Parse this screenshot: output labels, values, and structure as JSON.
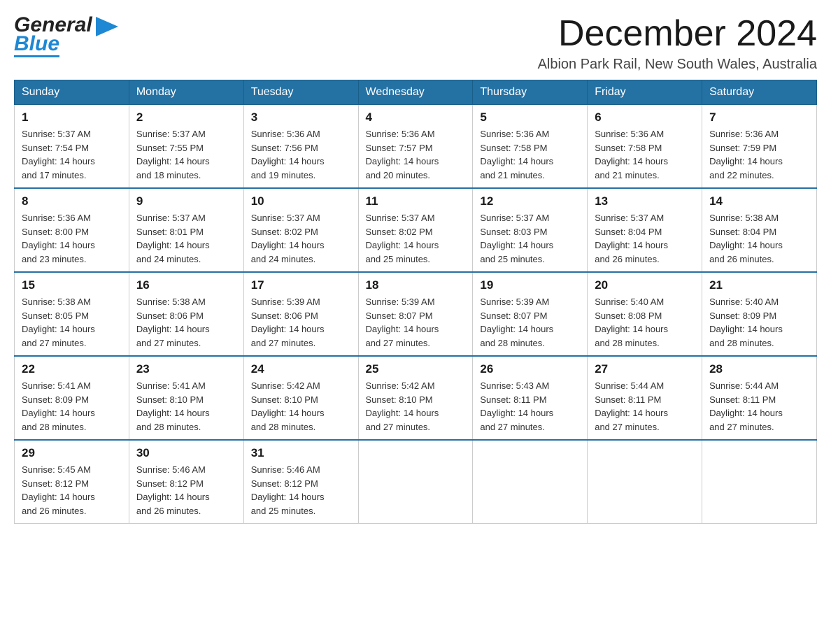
{
  "header": {
    "logo_general": "General",
    "logo_blue": "Blue",
    "month_title": "December 2024",
    "location": "Albion Park Rail, New South Wales, Australia"
  },
  "days_of_week": [
    "Sunday",
    "Monday",
    "Tuesday",
    "Wednesday",
    "Thursday",
    "Friday",
    "Saturday"
  ],
  "weeks": [
    [
      {
        "day": "1",
        "sunrise": "5:37 AM",
        "sunset": "7:54 PM",
        "daylight": "14 hours and 17 minutes."
      },
      {
        "day": "2",
        "sunrise": "5:37 AM",
        "sunset": "7:55 PM",
        "daylight": "14 hours and 18 minutes."
      },
      {
        "day": "3",
        "sunrise": "5:36 AM",
        "sunset": "7:56 PM",
        "daylight": "14 hours and 19 minutes."
      },
      {
        "day": "4",
        "sunrise": "5:36 AM",
        "sunset": "7:57 PM",
        "daylight": "14 hours and 20 minutes."
      },
      {
        "day": "5",
        "sunrise": "5:36 AM",
        "sunset": "7:58 PM",
        "daylight": "14 hours and 21 minutes."
      },
      {
        "day": "6",
        "sunrise": "5:36 AM",
        "sunset": "7:58 PM",
        "daylight": "14 hours and 21 minutes."
      },
      {
        "day": "7",
        "sunrise": "5:36 AM",
        "sunset": "7:59 PM",
        "daylight": "14 hours and 22 minutes."
      }
    ],
    [
      {
        "day": "8",
        "sunrise": "5:36 AM",
        "sunset": "8:00 PM",
        "daylight": "14 hours and 23 minutes."
      },
      {
        "day": "9",
        "sunrise": "5:37 AM",
        "sunset": "8:01 PM",
        "daylight": "14 hours and 24 minutes."
      },
      {
        "day": "10",
        "sunrise": "5:37 AM",
        "sunset": "8:02 PM",
        "daylight": "14 hours and 24 minutes."
      },
      {
        "day": "11",
        "sunrise": "5:37 AM",
        "sunset": "8:02 PM",
        "daylight": "14 hours and 25 minutes."
      },
      {
        "day": "12",
        "sunrise": "5:37 AM",
        "sunset": "8:03 PM",
        "daylight": "14 hours and 25 minutes."
      },
      {
        "day": "13",
        "sunrise": "5:37 AM",
        "sunset": "8:04 PM",
        "daylight": "14 hours and 26 minutes."
      },
      {
        "day": "14",
        "sunrise": "5:38 AM",
        "sunset": "8:04 PM",
        "daylight": "14 hours and 26 minutes."
      }
    ],
    [
      {
        "day": "15",
        "sunrise": "5:38 AM",
        "sunset": "8:05 PM",
        "daylight": "14 hours and 27 minutes."
      },
      {
        "day": "16",
        "sunrise": "5:38 AM",
        "sunset": "8:06 PM",
        "daylight": "14 hours and 27 minutes."
      },
      {
        "day": "17",
        "sunrise": "5:39 AM",
        "sunset": "8:06 PM",
        "daylight": "14 hours and 27 minutes."
      },
      {
        "day": "18",
        "sunrise": "5:39 AM",
        "sunset": "8:07 PM",
        "daylight": "14 hours and 27 minutes."
      },
      {
        "day": "19",
        "sunrise": "5:39 AM",
        "sunset": "8:07 PM",
        "daylight": "14 hours and 28 minutes."
      },
      {
        "day": "20",
        "sunrise": "5:40 AM",
        "sunset": "8:08 PM",
        "daylight": "14 hours and 28 minutes."
      },
      {
        "day": "21",
        "sunrise": "5:40 AM",
        "sunset": "8:09 PM",
        "daylight": "14 hours and 28 minutes."
      }
    ],
    [
      {
        "day": "22",
        "sunrise": "5:41 AM",
        "sunset": "8:09 PM",
        "daylight": "14 hours and 28 minutes."
      },
      {
        "day": "23",
        "sunrise": "5:41 AM",
        "sunset": "8:10 PM",
        "daylight": "14 hours and 28 minutes."
      },
      {
        "day": "24",
        "sunrise": "5:42 AM",
        "sunset": "8:10 PM",
        "daylight": "14 hours and 28 minutes."
      },
      {
        "day": "25",
        "sunrise": "5:42 AM",
        "sunset": "8:10 PM",
        "daylight": "14 hours and 27 minutes."
      },
      {
        "day": "26",
        "sunrise": "5:43 AM",
        "sunset": "8:11 PM",
        "daylight": "14 hours and 27 minutes."
      },
      {
        "day": "27",
        "sunrise": "5:44 AM",
        "sunset": "8:11 PM",
        "daylight": "14 hours and 27 minutes."
      },
      {
        "day": "28",
        "sunrise": "5:44 AM",
        "sunset": "8:11 PM",
        "daylight": "14 hours and 27 minutes."
      }
    ],
    [
      {
        "day": "29",
        "sunrise": "5:45 AM",
        "sunset": "8:12 PM",
        "daylight": "14 hours and 26 minutes."
      },
      {
        "day": "30",
        "sunrise": "5:46 AM",
        "sunset": "8:12 PM",
        "daylight": "14 hours and 26 minutes."
      },
      {
        "day": "31",
        "sunrise": "5:46 AM",
        "sunset": "8:12 PM",
        "daylight": "14 hours and 25 minutes."
      },
      null,
      null,
      null,
      null
    ]
  ],
  "labels": {
    "sunrise_prefix": "Sunrise: ",
    "sunset_prefix": "Sunset: ",
    "daylight_prefix": "Daylight: "
  }
}
